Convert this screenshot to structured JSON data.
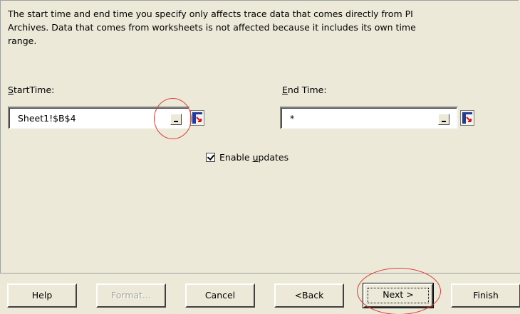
{
  "description": {
    "line1": "The start time and end time you specify only affects trace data that comes directly from PI",
    "line2": "Archives. Data that comes from worksheets is not affected because it includes its own time",
    "line3": "range."
  },
  "start_time": {
    "label_first": "S",
    "label_rest": "tartTime:",
    "value": "Sheet1!$B$4"
  },
  "end_time": {
    "label_first": "E",
    "label_rest": "nd Time:",
    "value": "*"
  },
  "enable_updates": {
    "label_before": "Enable ",
    "label_underlined": "u",
    "label_after": "pdates",
    "checked": true
  },
  "buttons": {
    "help": "Help",
    "format": "Format...",
    "cancel": "Cancel",
    "back": "<Back",
    "next": "Next >",
    "finish": "Finish"
  },
  "annotation_color": "#e03c3c"
}
